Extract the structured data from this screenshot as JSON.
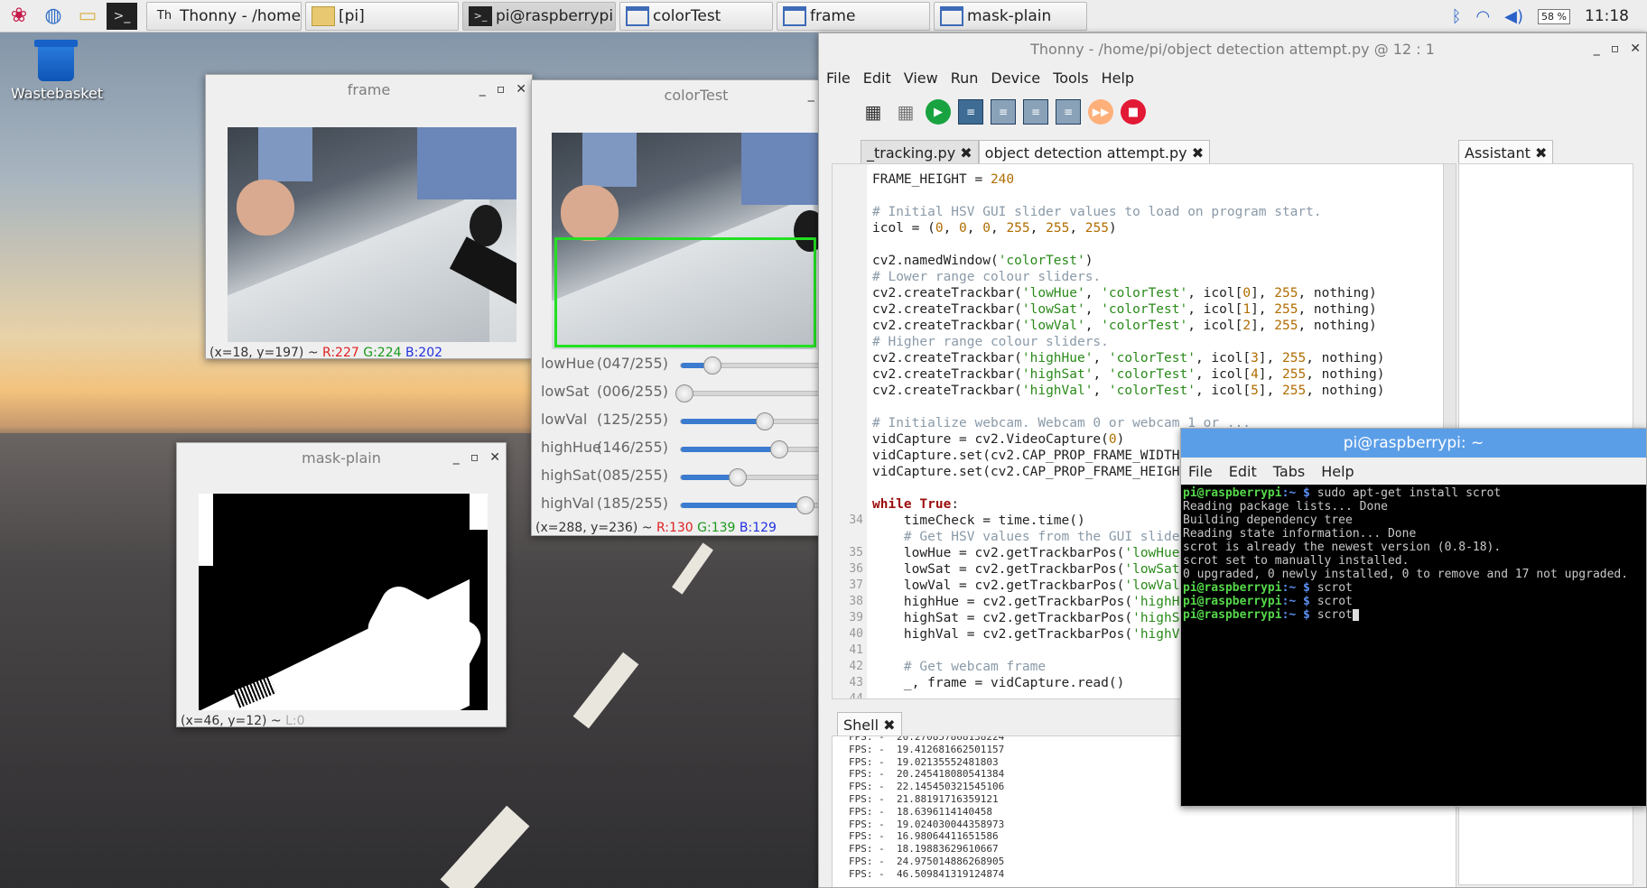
{
  "taskbar": {
    "tasks": [
      {
        "label": "Thonny  -  /home/pi/..."
      },
      {
        "label": "[pi]"
      },
      {
        "label": "pi@raspberrypi: ~"
      },
      {
        "label": "colorTest"
      },
      {
        "label": "frame"
      },
      {
        "label": "mask-plain"
      }
    ],
    "cpu": "58 %",
    "clock": "11:18"
  },
  "desktop": {
    "wastebasket": "Wastebasket"
  },
  "frame_win": {
    "title": "frame",
    "status_prefix": "(x=18, y=197) ~ ",
    "r": "R:227",
    "g": "G:224",
    "b": "B:202"
  },
  "colortest_win": {
    "title": "colorTest",
    "trackbars": [
      {
        "name": "lowHue",
        "value": "(047/255)",
        "pos": 47
      },
      {
        "name": "lowSat",
        "value": "(006/255)",
        "pos": 6
      },
      {
        "name": "lowVal",
        "value": "(125/255)",
        "pos": 125
      },
      {
        "name": "highHue",
        "value": "(146/255)",
        "pos": 146
      },
      {
        "name": "highSat",
        "value": "(085/255)",
        "pos": 85
      },
      {
        "name": "highVal",
        "value": "(185/255)",
        "pos": 185
      }
    ],
    "status_prefix": "(x=288, y=236) ~ ",
    "r": "R:130",
    "g": "G:139",
    "b": "B:129"
  },
  "mask_win": {
    "title": "mask-plain",
    "status_prefix": "(x=46, y=12) ~ ",
    "l": "L:0"
  },
  "thonny": {
    "title": "Thonny  -  /home/pi/object detection attempt.py  @  12 : 1",
    "menu": [
      "File",
      "Edit",
      "View",
      "Run",
      "Device",
      "Tools",
      "Help"
    ],
    "tabs": [
      {
        "label": "_tracking.py"
      },
      {
        "label": "object detection attempt.py"
      }
    ],
    "assistant_tab": "Assistant",
    "shell_tab": "Shell",
    "code": [
      {
        "n": "",
        "parts": [
          {
            "t": "FRAME_HEIGHT = ",
            "c": "c-fn"
          },
          {
            "t": "240",
            "c": "c-num"
          }
        ]
      },
      {
        "n": "",
        "parts": []
      },
      {
        "n": "",
        "parts": [
          {
            "t": "# Initial HSV GUI slider values to load on program start.",
            "c": "c-cm"
          }
        ]
      },
      {
        "n": "",
        "parts": [
          {
            "t": "icol = (",
            "c": "c-fn"
          },
          {
            "t": "0",
            "c": "c-num"
          },
          {
            "t": ", ",
            "c": "c-fn"
          },
          {
            "t": "0",
            "c": "c-num"
          },
          {
            "t": ", ",
            "c": "c-fn"
          },
          {
            "t": "0",
            "c": "c-num"
          },
          {
            "t": ", ",
            "c": "c-fn"
          },
          {
            "t": "255",
            "c": "c-num"
          },
          {
            "t": ", ",
            "c": "c-fn"
          },
          {
            "t": "255",
            "c": "c-num"
          },
          {
            "t": ", ",
            "c": "c-fn"
          },
          {
            "t": "255",
            "c": "c-num"
          },
          {
            "t": ")",
            "c": "c-fn"
          }
        ]
      },
      {
        "n": "",
        "parts": []
      },
      {
        "n": "",
        "parts": [
          {
            "t": "cv2.namedWindow(",
            "c": "c-fn"
          },
          {
            "t": "'colorTest'",
            "c": "c-str"
          },
          {
            "t": ")",
            "c": "c-fn"
          }
        ]
      },
      {
        "n": "",
        "parts": [
          {
            "t": "# Lower range colour sliders.",
            "c": "c-cm"
          }
        ]
      },
      {
        "n": "",
        "parts": [
          {
            "t": "cv2.createTrackbar(",
            "c": "c-fn"
          },
          {
            "t": "'lowHue'",
            "c": "c-str"
          },
          {
            "t": ", ",
            "c": "c-fn"
          },
          {
            "t": "'colorTest'",
            "c": "c-str"
          },
          {
            "t": ", icol[",
            "c": "c-fn"
          },
          {
            "t": "0",
            "c": "c-num"
          },
          {
            "t": "], ",
            "c": "c-fn"
          },
          {
            "t": "255",
            "c": "c-num"
          },
          {
            "t": ", nothing)",
            "c": "c-fn"
          }
        ]
      },
      {
        "n": "",
        "parts": [
          {
            "t": "cv2.createTrackbar(",
            "c": "c-fn"
          },
          {
            "t": "'lowSat'",
            "c": "c-str"
          },
          {
            "t": ", ",
            "c": "c-fn"
          },
          {
            "t": "'colorTest'",
            "c": "c-str"
          },
          {
            "t": ", icol[",
            "c": "c-fn"
          },
          {
            "t": "1",
            "c": "c-num"
          },
          {
            "t": "], ",
            "c": "c-fn"
          },
          {
            "t": "255",
            "c": "c-num"
          },
          {
            "t": ", nothing)",
            "c": "c-fn"
          }
        ]
      },
      {
        "n": "",
        "parts": [
          {
            "t": "cv2.createTrackbar(",
            "c": "c-fn"
          },
          {
            "t": "'lowVal'",
            "c": "c-str"
          },
          {
            "t": ", ",
            "c": "c-fn"
          },
          {
            "t": "'colorTest'",
            "c": "c-str"
          },
          {
            "t": ", icol[",
            "c": "c-fn"
          },
          {
            "t": "2",
            "c": "c-num"
          },
          {
            "t": "], ",
            "c": "c-fn"
          },
          {
            "t": "255",
            "c": "c-num"
          },
          {
            "t": ", nothing)",
            "c": "c-fn"
          }
        ]
      },
      {
        "n": "",
        "parts": [
          {
            "t": "# Higher range colour sliders.",
            "c": "c-cm"
          }
        ]
      },
      {
        "n": "",
        "parts": [
          {
            "t": "cv2.createTrackbar(",
            "c": "c-fn"
          },
          {
            "t": "'highHue'",
            "c": "c-str"
          },
          {
            "t": ", ",
            "c": "c-fn"
          },
          {
            "t": "'colorTest'",
            "c": "c-str"
          },
          {
            "t": ", icol[",
            "c": "c-fn"
          },
          {
            "t": "3",
            "c": "c-num"
          },
          {
            "t": "], ",
            "c": "c-fn"
          },
          {
            "t": "255",
            "c": "c-num"
          },
          {
            "t": ", nothing)",
            "c": "c-fn"
          }
        ]
      },
      {
        "n": "",
        "parts": [
          {
            "t": "cv2.createTrackbar(",
            "c": "c-fn"
          },
          {
            "t": "'highSat'",
            "c": "c-str"
          },
          {
            "t": ", ",
            "c": "c-fn"
          },
          {
            "t": "'colorTest'",
            "c": "c-str"
          },
          {
            "t": ", icol[",
            "c": "c-fn"
          },
          {
            "t": "4",
            "c": "c-num"
          },
          {
            "t": "], ",
            "c": "c-fn"
          },
          {
            "t": "255",
            "c": "c-num"
          },
          {
            "t": ", nothing)",
            "c": "c-fn"
          }
        ]
      },
      {
        "n": "",
        "parts": [
          {
            "t": "cv2.createTrackbar(",
            "c": "c-fn"
          },
          {
            "t": "'highVal'",
            "c": "c-str"
          },
          {
            "t": ", ",
            "c": "c-fn"
          },
          {
            "t": "'colorTest'",
            "c": "c-str"
          },
          {
            "t": ", icol[",
            "c": "c-fn"
          },
          {
            "t": "5",
            "c": "c-num"
          },
          {
            "t": "], ",
            "c": "c-fn"
          },
          {
            "t": "255",
            "c": "c-num"
          },
          {
            "t": ", nothing)",
            "c": "c-fn"
          }
        ]
      },
      {
        "n": "",
        "parts": []
      },
      {
        "n": "",
        "parts": [
          {
            "t": "# Initialize webcam. Webcam 0 or webcam 1 or ...",
            "c": "c-cm"
          }
        ]
      },
      {
        "n": "",
        "parts": [
          {
            "t": "vidCapture = cv2.VideoCapture(",
            "c": "c-fn"
          },
          {
            "t": "0",
            "c": "c-num"
          },
          {
            "t": ")",
            "c": "c-fn"
          }
        ]
      },
      {
        "n": "",
        "parts": [
          {
            "t": "vidCapture.set(cv2.CAP_PROP_FRAME_WIDTH",
            "c": "c-fn"
          }
        ]
      },
      {
        "n": "",
        "parts": [
          {
            "t": "vidCapture.set(cv2.CAP_PROP_FRAME_HEIGHT",
            "c": "c-fn"
          }
        ]
      },
      {
        "n": "",
        "parts": []
      },
      {
        "n": "",
        "parts": [
          {
            "t": "while",
            "c": "c-kw"
          },
          {
            "t": " ",
            "c": "c-fn"
          },
          {
            "t": "True",
            "c": "c-kw"
          },
          {
            "t": ":",
            "c": "c-fn"
          }
        ]
      },
      {
        "n": "34",
        "parts": [
          {
            "t": "    timeCheck = time.time()",
            "c": "c-fn"
          }
        ]
      },
      {
        "n": "",
        "parts": [
          {
            "t": "    # Get HSV values from the GUI sliders.",
            "c": "c-cm"
          }
        ]
      },
      {
        "n": "35",
        "parts": [
          {
            "t": "    lowHue = cv2.getTrackbarPos(",
            "c": "c-fn"
          },
          {
            "t": "'lowHue'",
            "c": "c-str"
          }
        ]
      },
      {
        "n": "36",
        "parts": [
          {
            "t": "    lowSat = cv2.getTrackbarPos(",
            "c": "c-fn"
          },
          {
            "t": "'lowSat'",
            "c": "c-str"
          }
        ]
      },
      {
        "n": "37",
        "parts": [
          {
            "t": "    lowVal = cv2.getTrackbarPos(",
            "c": "c-fn"
          },
          {
            "t": "'lowVal'",
            "c": "c-str"
          }
        ]
      },
      {
        "n": "38",
        "parts": [
          {
            "t": "    highHue = cv2.getTrackbarPos(",
            "c": "c-fn"
          },
          {
            "t": "'highHue'",
            "c": "c-str"
          }
        ]
      },
      {
        "n": "39",
        "parts": [
          {
            "t": "    highSat = cv2.getTrackbarPos(",
            "c": "c-fn"
          },
          {
            "t": "'highSat'",
            "c": "c-str"
          }
        ]
      },
      {
        "n": "40",
        "parts": [
          {
            "t": "    highVal = cv2.getTrackbarPos(",
            "c": "c-fn"
          },
          {
            "t": "'highVal'",
            "c": "c-str"
          }
        ]
      },
      {
        "n": "41",
        "parts": []
      },
      {
        "n": "42",
        "parts": [
          {
            "t": "    # Get webcam frame",
            "c": "c-cm"
          }
        ]
      },
      {
        "n": "43",
        "parts": [
          {
            "t": "    _, frame = vidCapture.read()",
            "c": "c-fn"
          }
        ]
      },
      {
        "n": "44",
        "parts": []
      }
    ],
    "shell": [
      "FPS: -  20.270857868138224",
      "FPS: -  19.412681662501157",
      "FPS: -  19.02135552481803",
      "FPS: -  20.245418080541384",
      "FPS: -  22.145450321545106",
      "FPS: -  21.88191716359121",
      "FPS: -  18.6396114140458",
      "FPS: -  19.024030044358973",
      "FPS: -  16.98064411651586",
      "FPS: -  18.19883629610667",
      "FPS: -  24.975014886268905",
      "FPS: -  46.509841319124874"
    ]
  },
  "terminal": {
    "title": "pi@raspberrypi: ~",
    "menu": [
      "File",
      "Edit",
      "Tabs",
      "Help"
    ],
    "lines": [
      {
        "prompt": "pi@raspberrypi",
        "path": ":~ $ ",
        "text": "sudo apt-get install scrot"
      },
      {
        "prompt": "",
        "path": "",
        "text": "Reading package lists... Done"
      },
      {
        "prompt": "",
        "path": "",
        "text": "Building dependency tree"
      },
      {
        "prompt": "",
        "path": "",
        "text": "Reading state information... Done"
      },
      {
        "prompt": "",
        "path": "",
        "text": "scrot is already the newest version (0.8-18)."
      },
      {
        "prompt": "",
        "path": "",
        "text": "scrot set to manually installed."
      },
      {
        "prompt": "",
        "path": "",
        "text": "0 upgraded, 0 newly installed, 0 to remove and 17 not upgraded."
      },
      {
        "prompt": "pi@raspberrypi",
        "path": ":~ $ ",
        "text": "scrot"
      },
      {
        "prompt": "pi@raspberrypi",
        "path": ":~ $ ",
        "text": "scrot"
      },
      {
        "prompt": "pi@raspberrypi",
        "path": ":~ $ ",
        "text": "scrot"
      }
    ]
  }
}
